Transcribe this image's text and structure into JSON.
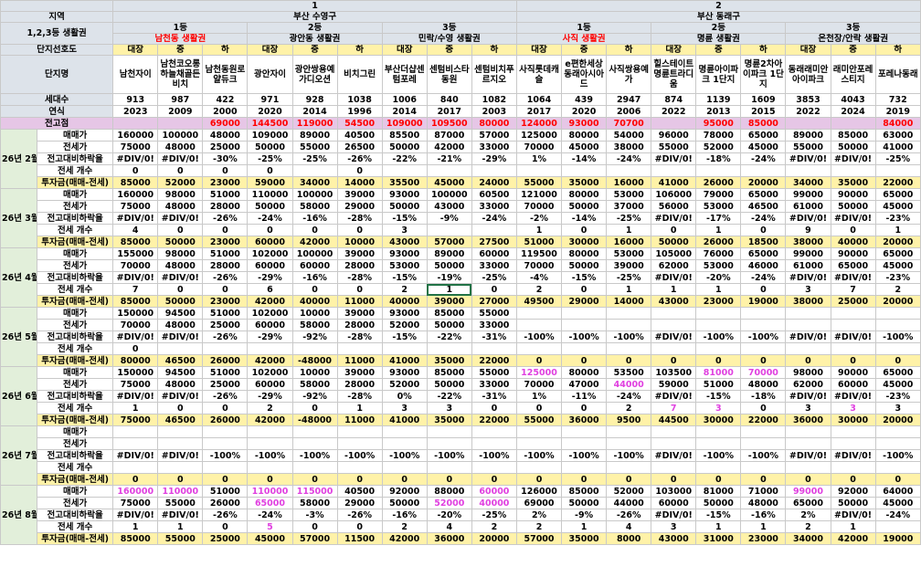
{
  "header": {
    "region_label": "지역",
    "region_groups": [
      {
        "num": "1",
        "name": "부산 수영구"
      },
      {
        "num": "2",
        "name": "부산 동래구"
      }
    ],
    "zone_label": "1,2,3등 생활권",
    "zones": [
      {
        "rank": "1등",
        "name": "남천동 생활권",
        "red": true
      },
      {
        "rank": "2등",
        "name": "광안동 생활권",
        "red": false
      },
      {
        "rank": "3등",
        "name": "민락/수영 생활권",
        "red": false
      },
      {
        "rank": "1등",
        "name": "사직 생활권",
        "red": true
      },
      {
        "rank": "2등",
        "name": "명륜 생활권",
        "red": false
      },
      {
        "rank": "3등",
        "name": "온천장/안락 생활권",
        "red": false
      }
    ],
    "pref_label": "단지선호도",
    "prefs": [
      "대장",
      "중",
      "하",
      "대장",
      "중",
      "하",
      "대장",
      "중",
      "하",
      "대장",
      "중",
      "하",
      "대장",
      "중",
      "하",
      "대장",
      "중",
      "하"
    ],
    "complex_label": "단지명",
    "complexes": [
      "남천자이",
      "남천코오롱하늘채골든비치",
      "남천동원로얄듀크",
      "광안자이",
      "광안쌍용예가디오션",
      "비치그린",
      "부산더샵센텀포레",
      "센텀비스타동원",
      "센텀비치푸르지오",
      "사직롯데캐슬",
      "e편한세상동래아시아드",
      "사직쌍용예가",
      "힐스테이트명륜트라디움",
      "명륜아이파크 1단지",
      "명륜2차아이파크 1단지",
      "동래래미안아이파크",
      "래미안포레스티지",
      "포레나동래"
    ],
    "households_label": "세대수",
    "households": [
      "913",
      "987",
      "422",
      "971",
      "928",
      "1038",
      "1006",
      "840",
      "1082",
      "1064",
      "439",
      "2947",
      "874",
      "1139",
      "1609",
      "3853",
      "4043",
      "732"
    ],
    "year_label": "연식",
    "years": [
      "2023",
      "2009",
      "2000",
      "2020",
      "2014",
      "1996",
      "2014",
      "2017",
      "2003",
      "2017",
      "2020",
      "2006",
      "2022",
      "2013",
      "2015",
      "2022",
      "2024",
      "2019"
    ],
    "peak_label": "전고점",
    "peaks": [
      "",
      "",
      "69000",
      "144500",
      "119000",
      "54500",
      "109000",
      "109500",
      "80000",
      "124000",
      "93000",
      "70700",
      "",
      "95000",
      "85000",
      "",
      "",
      "84000"
    ]
  },
  "metric_labels": [
    "매매가",
    "전세가",
    "전고대비하락율",
    "전세 개수",
    "투자금(매매-전세)"
  ],
  "months": [
    {
      "label": "26년 2월",
      "rows": [
        [
          "160000",
          "100000",
          "48000",
          "109000",
          "89000",
          "40500",
          "85500",
          "87000",
          "57000",
          "125000",
          "80000",
          "54000",
          "96000",
          "78000",
          "65000",
          "89000",
          "85000",
          "63000"
        ],
        [
          "75000",
          "48000",
          "25000",
          "50000",
          "55000",
          "26500",
          "50000",
          "42000",
          "33000",
          "70000",
          "45000",
          "38000",
          "55000",
          "52000",
          "45000",
          "55000",
          "50000",
          "41000"
        ],
        [
          "#DIV/0!",
          "#DIV/0!",
          "-30%",
          "-25%",
          "-25%",
          "-26%",
          "-22%",
          "-21%",
          "-29%",
          "1%",
          "-14%",
          "-24%",
          "#DIV/0!",
          "-18%",
          "-24%",
          "#DIV/0!",
          "#DIV/0!",
          "-25%"
        ],
        [
          "0",
          "0",
          "0",
          "0",
          "",
          "0",
          "",
          "",
          "",
          "",
          "",
          "",
          "",
          "",
          "",
          "",
          "",
          ""
        ],
        [
          "85000",
          "52000",
          "23000",
          "59000",
          "34000",
          "14000",
          "35500",
          "45000",
          "24000",
          "55000",
          "35000",
          "16000",
          "41000",
          "26000",
          "20000",
          "34000",
          "35000",
          "22000"
        ]
      ]
    },
    {
      "label": "26년 3월",
      "rows": [
        [
          "160000",
          "98000",
          "51000",
          "110000",
          "100000",
          "39000",
          "93000",
          "100000",
          "60500",
          "121000",
          "80000",
          "53000",
          "106000",
          "79000",
          "65000",
          "99000",
          "90000",
          "65000"
        ],
        [
          "75000",
          "48000",
          "28000",
          "50000",
          "58000",
          "29000",
          "50000",
          "43000",
          "33000",
          "70000",
          "50000",
          "37000",
          "56000",
          "53000",
          "46500",
          "61000",
          "50000",
          "45000"
        ],
        [
          "#DIV/0!",
          "#DIV/0!",
          "-26%",
          "-24%",
          "-16%",
          "-28%",
          "-15%",
          "-9%",
          "-24%",
          "-2%",
          "-14%",
          "-25%",
          "#DIV/0!",
          "-17%",
          "-24%",
          "#DIV/0!",
          "#DIV/0!",
          "-23%"
        ],
        [
          "4",
          "0",
          "0",
          "0",
          "0",
          "0",
          "3",
          "",
          "",
          "1",
          "0",
          "1",
          "0",
          "1",
          "0",
          "9",
          "0",
          "1"
        ],
        [
          "85000",
          "50000",
          "23000",
          "60000",
          "42000",
          "10000",
          "43000",
          "57000",
          "27500",
          "51000",
          "30000",
          "16000",
          "50000",
          "26000",
          "18500",
          "38000",
          "40000",
          "20000"
        ]
      ]
    },
    {
      "label": "26년 4월",
      "rows": [
        [
          "155000",
          "98000",
          "51000",
          "102000",
          "100000",
          "39000",
          "93000",
          "89000",
          "60000",
          "119500",
          "80000",
          "53000",
          "105000",
          "76000",
          "65000",
          "99000",
          "90000",
          "65000"
        ],
        [
          "70000",
          "48000",
          "28000",
          "60000",
          "60000",
          "28000",
          "53000",
          "50000",
          "33000",
          "70000",
          "50000",
          "39000",
          "62000",
          "53000",
          "46000",
          "61000",
          "65000",
          "45000"
        ],
        [
          "#DIV/0!",
          "#DIV/0!",
          "-26%",
          "-29%",
          "-16%",
          "-28%",
          "-15%",
          "-19%",
          "-25%",
          "-4%",
          "-15%",
          "-25%",
          "#DIV/0!",
          "-20%",
          "-24%",
          "#DIV/0!",
          "#DIV/0!",
          "-23%"
        ],
        [
          "7",
          "0",
          "0",
          "6",
          "0",
          "0",
          "2",
          "1",
          "0",
          "2",
          "0",
          "1",
          "1",
          "1",
          "0",
          "3",
          "7",
          "2"
        ],
        [
          "85000",
          "50000",
          "23000",
          "42000",
          "40000",
          "11000",
          "40000",
          "39000",
          "27000",
          "49500",
          "29000",
          "14000",
          "43000",
          "23000",
          "19000",
          "38000",
          "25000",
          "20000"
        ]
      ]
    },
    {
      "label": "26년 5월",
      "rows": [
        [
          "150000",
          "94500",
          "51000",
          "102000",
          "10000",
          "39000",
          "93000",
          "85000",
          "55000",
          "",
          "",
          "",
          "",
          "",
          "",
          "",
          "",
          ""
        ],
        [
          "70000",
          "48000",
          "25000",
          "60000",
          "58000",
          "28000",
          "52000",
          "50000",
          "33000",
          "",
          "",
          "",
          "",
          "",
          "",
          "",
          "",
          ""
        ],
        [
          "#DIV/0!",
          "#DIV/0!",
          "-26%",
          "-29%",
          "-92%",
          "-28%",
          "-15%",
          "-22%",
          "-31%",
          "-100%",
          "-100%",
          "-100%",
          "#DIV/0!",
          "-100%",
          "-100%",
          "#DIV/0!",
          "#DIV/0!",
          "-100%"
        ],
        [
          "0",
          "",
          "",
          "",
          "",
          "",
          "",
          "",
          "",
          "",
          "",
          "",
          "",
          "",
          "",
          "",
          "",
          ""
        ],
        [
          "80000",
          "46500",
          "26000",
          "42000",
          "-48000",
          "11000",
          "41000",
          "35000",
          "22000",
          "0",
          "0",
          "0",
          "0",
          "0",
          "0",
          "0",
          "0",
          "0"
        ]
      ]
    },
    {
      "label": "26년 6월",
      "rows": [
        [
          "150000",
          "94500",
          "51000",
          "102000",
          "10000",
          "39000",
          "93000",
          "85000",
          "55000",
          "125000",
          "80000",
          "53500",
          "103500",
          "81000",
          "70000",
          "98000",
          "90000",
          "65000"
        ],
        [
          "75000",
          "48000",
          "25000",
          "60000",
          "58000",
          "28000",
          "52000",
          "50000",
          "33000",
          "70000",
          "47000",
          "44000",
          "59000",
          "51000",
          "48000",
          "62000",
          "60000",
          "45000"
        ],
        [
          "#DIV/0!",
          "#DIV/0!",
          "-26%",
          "-29%",
          "-92%",
          "-28%",
          "0%",
          "-22%",
          "-31%",
          "1%",
          "-11%",
          "-24%",
          "#DIV/0!",
          "-15%",
          "-18%",
          "#DIV/0!",
          "#DIV/0!",
          "-23%"
        ],
        [
          "1",
          "0",
          "0",
          "2",
          "0",
          "1",
          "3",
          "3",
          "0",
          "0",
          "0",
          "2",
          "7",
          "3",
          "0",
          "3",
          "3",
          "3"
        ],
        [
          "75000",
          "46500",
          "26000",
          "42000",
          "-48000",
          "11000",
          "41000",
          "35000",
          "22000",
          "55000",
          "36000",
          "9500",
          "44500",
          "30000",
          "22000",
          "36000",
          "30000",
          "20000"
        ]
      ]
    },
    {
      "label": "26년 7월",
      "rows": [
        [
          "",
          "",
          "",
          "",
          "",
          "",
          "",
          "",
          "",
          "",
          "",
          "",
          "",
          "",
          "",
          "",
          "",
          ""
        ],
        [
          "",
          "",
          "",
          "",
          "",
          "",
          "",
          "",
          "",
          "",
          "",
          "",
          "",
          "",
          "",
          "",
          "",
          ""
        ],
        [
          "#DIV/0!",
          "#DIV/0!",
          "-100%",
          "-100%",
          "-100%",
          "-100%",
          "-100%",
          "-100%",
          "-100%",
          "-100%",
          "-100%",
          "-100%",
          "#DIV/0!",
          "-100%",
          "-100%",
          "#DIV/0!",
          "#DIV/0!",
          "-100%"
        ],
        [
          "",
          "",
          "",
          "",
          "",
          "",
          "",
          "",
          "",
          "",
          "",
          "",
          "",
          "",
          "",
          "",
          "",
          ""
        ],
        [
          "0",
          "0",
          "0",
          "0",
          "0",
          "0",
          "0",
          "0",
          "0",
          "0",
          "0",
          "0",
          "0",
          "0",
          "0",
          "0",
          "0",
          "0"
        ]
      ]
    },
    {
      "label": "26년 8월",
      "rows": [
        [
          "160000",
          "110000",
          "51000",
          "110000",
          "115000",
          "40500",
          "92000",
          "88000",
          "60000",
          "126000",
          "85000",
          "52000",
          "103000",
          "81000",
          "71000",
          "99000",
          "92000",
          "64000"
        ],
        [
          "75000",
          "55000",
          "26000",
          "65000",
          "58000",
          "29000",
          "50000",
          "52000",
          "40000",
          "69000",
          "50000",
          "44000",
          "60000",
          "50000",
          "48000",
          "65000",
          "50000",
          "45000"
        ],
        [
          "#DIV/0!",
          "#DIV/0!",
          "-26%",
          "-24%",
          "-3%",
          "-26%",
          "-16%",
          "-20%",
          "-25%",
          "2%",
          "-9%",
          "-26%",
          "#DIV/0!",
          "-15%",
          "-16%",
          "2%",
          "#DIV/0!",
          "-24%"
        ],
        [
          "1",
          "1",
          "0",
          "5",
          "0",
          "0",
          "2",
          "4",
          "2",
          "2",
          "1",
          "4",
          "3",
          "1",
          "1",
          "2",
          "1",
          ""
        ],
        [
          "85000",
          "55000",
          "25000",
          "45000",
          "57000",
          "11500",
          "42000",
          "36000",
          "20000",
          "57000",
          "35000",
          "8000",
          "43000",
          "31000",
          "23000",
          "34000",
          "42000",
          "19000"
        ]
      ]
    }
  ]
}
